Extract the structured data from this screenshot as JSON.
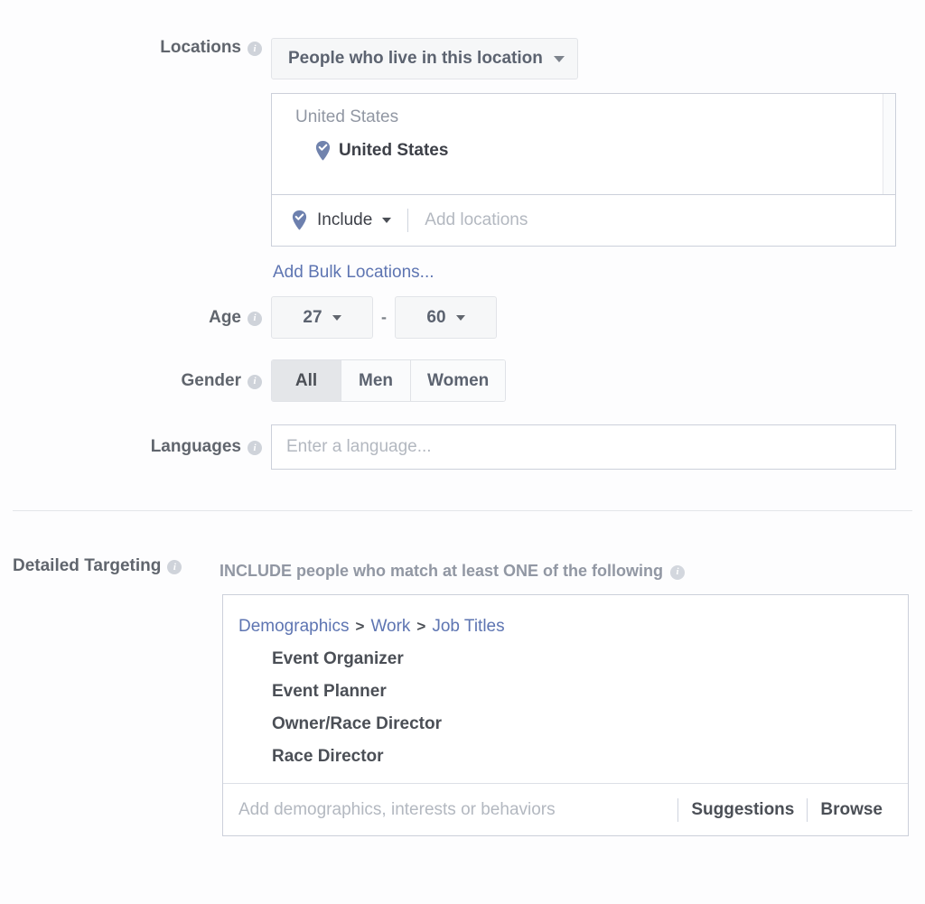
{
  "locations": {
    "label": "Locations",
    "info_icon": "info-icon",
    "scope_dropdown": {
      "value": "People who live in this location",
      "caret_icon": "chevron-down-icon"
    },
    "list_heading": "United States",
    "selected": [
      {
        "name": "United States",
        "icon": "map-pin-check-icon"
      }
    ],
    "include_dropdown": {
      "value": "Include",
      "icon": "map-pin-check-icon",
      "caret_icon": "chevron-down-icon"
    },
    "add_placeholder": "Add locations",
    "bulk_link": "Add Bulk Locations..."
  },
  "age": {
    "label": "Age",
    "min": "27",
    "max": "60",
    "separator": "-"
  },
  "gender": {
    "label": "Gender",
    "options": [
      {
        "label": "All",
        "selected": true
      },
      {
        "label": "Men",
        "selected": false
      },
      {
        "label": "Women",
        "selected": false
      }
    ]
  },
  "languages": {
    "label": "Languages",
    "placeholder": "Enter a language..."
  },
  "detailed_targeting": {
    "label": "Detailed Targeting",
    "subtitle": "INCLUDE people who match at least ONE of the following",
    "breadcrumb": {
      "parts": [
        "Demographics",
        "Work",
        "Job Titles"
      ],
      "separator": ">"
    },
    "items": [
      "Event Organizer",
      "Event Planner",
      "Owner/Race Director",
      "Race Director"
    ],
    "input_placeholder": "Add demographics, interests or behaviors",
    "actions": [
      "Suggestions",
      "Browse"
    ]
  },
  "colors": {
    "link": "#5e75b2",
    "pin": "#7183ad",
    "label_text": "#60656d",
    "muted_text": "#9197a3",
    "placeholder": "#b3b8c0",
    "border": "#ccd0da",
    "selected_segment": "#e4e6e9"
  }
}
